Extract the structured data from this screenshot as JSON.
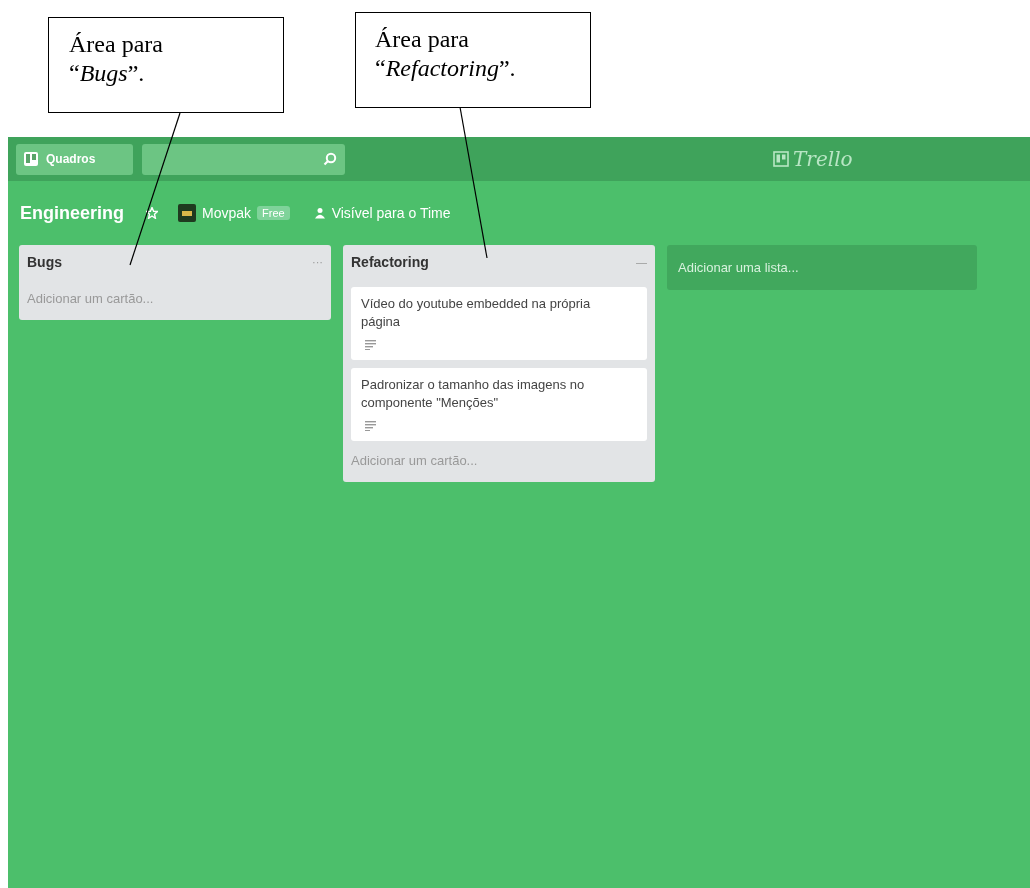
{
  "callouts": [
    {
      "text": "Área para “*Bugs*”."
    },
    {
      "text": "Área para “*Refactoring*”."
    }
  ],
  "header": {
    "boards_button": "Quadros",
    "logo": "Trello"
  },
  "board": {
    "title": "Engineering",
    "team": "Movpak",
    "plan": "Free",
    "visibility": "Visível para o Time"
  },
  "lists": [
    {
      "title": "Bugs",
      "menu": "···",
      "add_card": "Adicionar um cartão..."
    },
    {
      "title": "Refactoring",
      "menu": "—",
      "cards": [
        {
          "text": "Vídeo do youtube embedded na própria página",
          "has_description": true
        },
        {
          "text": "Padronizar o tamanho das imagens no componente \"Menções\"",
          "has_description": true
        }
      ],
      "add_card": "Adicionar um cartão..."
    }
  ],
  "add_list": "Adicionar uma lista..."
}
